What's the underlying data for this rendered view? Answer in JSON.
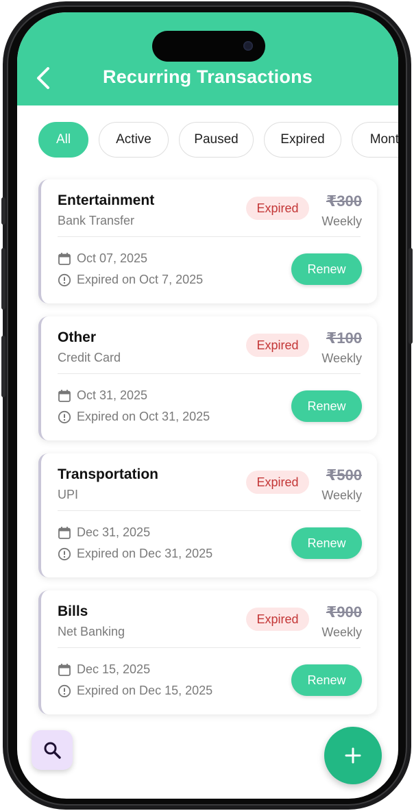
{
  "header": {
    "title": "Recurring Transactions",
    "back_icon": "chevron-left-icon",
    "color": "#3ecf9c"
  },
  "filters": [
    {
      "label": "All",
      "active": true
    },
    {
      "label": "Active",
      "active": false
    },
    {
      "label": "Paused",
      "active": false
    },
    {
      "label": "Expired",
      "active": false
    },
    {
      "label": "Monthly",
      "active": false
    }
  ],
  "transactions": [
    {
      "category": "Entertainment",
      "method": "Bank Transfer",
      "status": "Expired",
      "amount": "₹300",
      "frequency": "Weekly",
      "date": "Oct 07, 2025",
      "expired_text": "Expired on Oct 7, 2025",
      "action_label": "Renew"
    },
    {
      "category": "Other",
      "method": "Credit Card",
      "status": "Expired",
      "amount": "₹100",
      "frequency": "Weekly",
      "date": "Oct 31, 2025",
      "expired_text": "Expired on Oct 31, 2025",
      "action_label": "Renew"
    },
    {
      "category": "Transportation",
      "method": "UPI",
      "status": "Expired",
      "amount": "₹500",
      "frequency": "Weekly",
      "date": "Dec 31, 2025",
      "expired_text": "Expired on Dec 31, 2025",
      "action_label": "Renew"
    },
    {
      "category": "Bills",
      "method": "Net Banking",
      "status": "Expired",
      "amount": "₹900",
      "frequency": "Weekly",
      "date": "Dec 15, 2025",
      "expired_text": "Expired on Dec 15, 2025",
      "action_label": "Renew"
    }
  ],
  "fab": {
    "search_icon": "search-icon",
    "add_icon": "plus-icon"
  },
  "colors": {
    "accent": "#3ecf9c",
    "expired_badge_bg": "#fde6e6",
    "expired_badge_text": "#c33636",
    "search_fab_bg": "#ece0fb"
  }
}
